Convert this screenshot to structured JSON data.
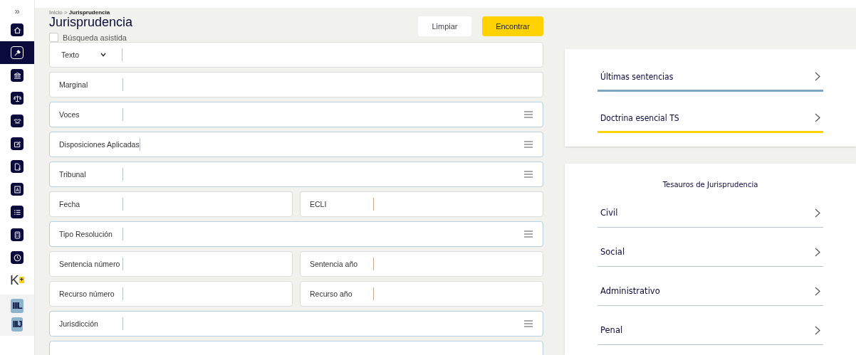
{
  "sidebar": {
    "toggle": "»",
    "items": [
      {
        "selected": false
      },
      {
        "selected": true
      },
      {
        "selected": false
      },
      {
        "selected": false
      },
      {
        "selected": false
      },
      {
        "selected": false
      },
      {
        "selected": false
      },
      {
        "selected": false
      },
      {
        "selected": false
      },
      {
        "selected": false
      },
      {
        "selected": false
      }
    ],
    "brand": {
      "letter": "K",
      "badge": "+"
    },
    "apps": [
      "IIIL",
      "IIIJ"
    ]
  },
  "breadcrumb": {
    "root": "Inicio",
    "separator": ">",
    "current": "Jurisprudencia"
  },
  "title": "Jurisprudencia",
  "assisted_search": {
    "label": "Búsqueda asistida",
    "checked": false
  },
  "buttons": {
    "clear": "Limpiar",
    "find": "Encontrar"
  },
  "form": {
    "rows": [
      {
        "kind": "select",
        "cells": [
          {
            "label": "Texto"
          }
        ]
      },
      {
        "kind": "text",
        "cells": [
          {
            "label": "Marginal"
          }
        ]
      },
      {
        "kind": "list",
        "cells": [
          {
            "label": "Voces"
          }
        ]
      },
      {
        "kind": "list",
        "cells": [
          {
            "label": "Disposiciones Aplicadas"
          }
        ]
      },
      {
        "kind": "list",
        "cells": [
          {
            "label": "Tribunal"
          }
        ]
      },
      {
        "kind": "pair",
        "cells": [
          {
            "label": "Fecha"
          },
          {
            "label": "ECLI"
          }
        ]
      },
      {
        "kind": "list",
        "cells": [
          {
            "label": "Tipo Resolución"
          }
        ]
      },
      {
        "kind": "pair",
        "cells": [
          {
            "label": "Sentencia número"
          },
          {
            "label": "Sentencia año"
          }
        ]
      },
      {
        "kind": "pair",
        "cells": [
          {
            "label": "Recurso número"
          },
          {
            "label": "Recurso año"
          }
        ]
      },
      {
        "kind": "list",
        "cells": [
          {
            "label": "Jurisdicción"
          }
        ]
      },
      {
        "kind": "blank",
        "cells": []
      }
    ]
  },
  "quick_links": [
    {
      "label": "Últimas sentencias",
      "color": "#7fa7c4"
    },
    {
      "label": "Doctrina esencial TS",
      "color": "#ffd200"
    }
  ],
  "thesaurus": {
    "title": "Tesauros de Jurisprudencia",
    "items": [
      "Civil",
      "Social",
      "Administrativo",
      "Penal"
    ]
  }
}
